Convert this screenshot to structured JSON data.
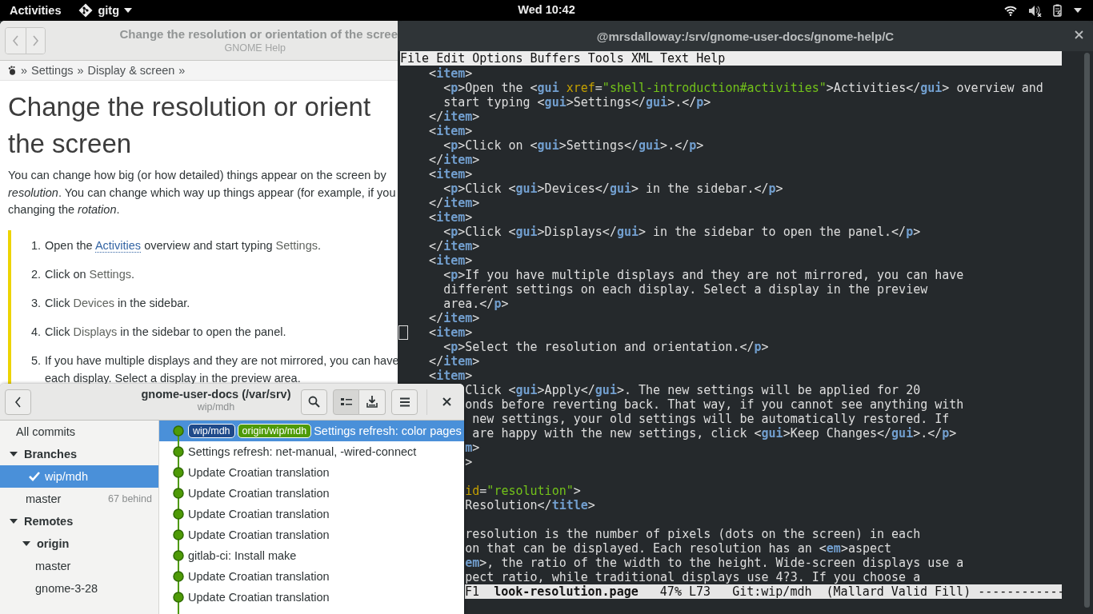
{
  "top_bar": {
    "activities": "Activities",
    "app_menu": "gitg",
    "clock": "Wed 10:42"
  },
  "help_window": {
    "title": "Change the resolution or orientation of the scree",
    "subtitle": "GNOME Help",
    "breadcrumb": [
      "»",
      "Settings",
      "»",
      "Display & screen",
      "»"
    ],
    "heading_lines": [
      "Change the resolution or orient",
      "the screen"
    ],
    "intro_lines": [
      "You can change how big (or how detailed) things appear on the screen by",
      "*resolution*. You can change which way up things appear (for example, if you",
      "changing the *rotation*."
    ],
    "steps": [
      {
        "number": "1.",
        "lines": [
          [
            {
              "kind": "text",
              "text": "Open the "
            },
            {
              "kind": "link",
              "text": "Activities"
            },
            {
              "kind": "text",
              "text": " overview and start typing "
            },
            {
              "kind": "gui",
              "text": "Settings"
            },
            {
              "kind": "text",
              "text": "."
            }
          ]
        ]
      },
      {
        "number": "2.",
        "lines": [
          [
            {
              "kind": "text",
              "text": "Click on "
            },
            {
              "kind": "gui",
              "text": "Settings"
            },
            {
              "kind": "text",
              "text": "."
            }
          ]
        ]
      },
      {
        "number": "3.",
        "lines": [
          [
            {
              "kind": "text",
              "text": "Click "
            },
            {
              "kind": "gui",
              "text": "Devices"
            },
            {
              "kind": "text",
              "text": " in the sidebar."
            }
          ]
        ]
      },
      {
        "number": "4.",
        "lines": [
          [
            {
              "kind": "text",
              "text": "Click "
            },
            {
              "kind": "gui",
              "text": "Displays"
            },
            {
              "kind": "text",
              "text": " in the sidebar to open the panel."
            }
          ]
        ]
      },
      {
        "number": "5.",
        "lines": [
          [
            {
              "kind": "text",
              "text": "If you have multiple displays and they are not mirrored, you can have"
            }
          ],
          [
            {
              "kind": "text",
              "text": "each display. Select a display in the preview area."
            }
          ]
        ]
      }
    ]
  },
  "emacs_window": {
    "title": "@mrsdalloway:/srv/gnome-user-docs/gnome-help/C",
    "menu": [
      "File",
      "Edit",
      "Options",
      "Buffers",
      "Tools",
      "XML",
      "Text",
      "Help"
    ],
    "lines": [
      {
        "kind": "code",
        "text": "    <item>",
        "cut": false,
        "cursor": false
      },
      {
        "kind": "code",
        "text": "      <p>Open the <gui xref=\"shell-introduction#activities\">Activities</gui> overview and",
        "cut": false,
        "cursor": false
      },
      {
        "kind": "code",
        "text": "      start typing <gui>Settings</gui>.</p>",
        "cut": false,
        "cursor": false
      },
      {
        "kind": "code",
        "text": "    </item>",
        "cut": false,
        "cursor": false
      },
      {
        "kind": "code",
        "text": "    <item>",
        "cut": false,
        "cursor": false
      },
      {
        "kind": "code",
        "text": "      <p>Click on <gui>Settings</gui>.</p>",
        "cut": false,
        "cursor": false
      },
      {
        "kind": "code",
        "text": "    </item>",
        "cut": false,
        "cursor": false
      },
      {
        "kind": "code",
        "text": "    <item>",
        "cut": false,
        "cursor": false
      },
      {
        "kind": "code",
        "text": "      <p>Click <gui>Devices</gui> in the sidebar.</p>",
        "cut": false,
        "cursor": false
      },
      {
        "kind": "code",
        "text": "    </item>",
        "cut": false,
        "cursor": false
      },
      {
        "kind": "code",
        "text": "    <item>",
        "cut": false,
        "cursor": false
      },
      {
        "kind": "code",
        "text": "      <p>Click <gui>Displays</gui> in the sidebar to open the panel.</p>",
        "cut": false,
        "cursor": false
      },
      {
        "kind": "code",
        "text": "    </item>",
        "cut": false,
        "cursor": false
      },
      {
        "kind": "code",
        "text": "    <item>",
        "cut": false,
        "cursor": false
      },
      {
        "kind": "code",
        "text": "      <p>If you have multiple displays and they are not mirrored, you can have",
        "cut": false,
        "cursor": false
      },
      {
        "kind": "code",
        "text": "      different settings on each display. Select a display in the preview",
        "cut": false,
        "cursor": false
      },
      {
        "kind": "code",
        "text": "      area.</p>",
        "cut": false,
        "cursor": false
      },
      {
        "kind": "code",
        "text": "    </item>",
        "cut": false,
        "cursor": false
      },
      {
        "kind": "code",
        "text": "    <item>",
        "cut": false,
        "cursor": true
      },
      {
        "kind": "code",
        "text": "      <p>Select the resolution and orientation.</p>",
        "cut": false,
        "cursor": false
      },
      {
        "kind": "code",
        "text": "    </item>",
        "cut": false,
        "cursor": false
      },
      {
        "kind": "code",
        "text": "    <item>",
        "cut": false,
        "cursor": false
      },
      {
        "kind": "code",
        "text": "Click <gui>Apply</gui>. The new settings will be applied for 20",
        "cut": true,
        "cursor": false
      },
      {
        "kind": "code",
        "text": "onds before reverting back. That way, if you cannot see anything with",
        "cut": true,
        "cursor": false
      },
      {
        "kind": "code",
        "text": " new settings, your old settings will be automatically restored. If",
        "cut": true,
        "cursor": false
      },
      {
        "kind": "code",
        "text": " are happy with the new settings, click <gui>Keep Changes</gui>.</p>",
        "cut": true,
        "cursor": false
      },
      {
        "kind": "code",
        "text": "m>",
        "cut": true,
        "cursor": false
      },
      {
        "kind": "code",
        "text": ">",
        "cut": true,
        "cursor": false
      },
      {
        "kind": "blank"
      },
      {
        "kind": "code",
        "text": "id=\"resolution\">",
        "cut": true,
        "cursor": false
      },
      {
        "kind": "code",
        "text": "Resolution</title>",
        "cut": true,
        "cursor": false
      },
      {
        "kind": "blank"
      },
      {
        "kind": "code",
        "text": "resolution is the number of pixels (dots on the screen) in each",
        "cut": true,
        "cursor": false
      },
      {
        "kind": "code",
        "text": "on that can be displayed. Each resolution has an <em>aspect",
        "cut": true,
        "cursor": false
      },
      {
        "kind": "code",
        "text": "em>, the ratio of the width to the height. Wide-screen displays use a",
        "cut": true,
        "cursor": false
      },
      {
        "kind": "code",
        "text": "pect ratio, while traditional displays use 4?3. If you choose a",
        "cut": true,
        "cursor": false
      }
    ],
    "mode_line": "F1  **look-resolution.page**   47% L73   Git:wip/mdh  (Mallard Valid Fill) ------------"
  },
  "gitg_window": {
    "title": "gnome-user-docs (/var/srv)",
    "subtitle": "wip/mdh",
    "view_toggles": [
      {
        "kind": "list",
        "selected": true
      },
      {
        "kind": "download",
        "selected": false
      }
    ],
    "sidebar": [
      {
        "kind": "item",
        "label": "All commits",
        "selected": false
      },
      {
        "kind": "group",
        "label": "Branches",
        "expanded": true,
        "children": [
          {
            "kind": "item",
            "label": "wip/mdh",
            "selected": true,
            "checked": true
          },
          {
            "kind": "item",
            "label": "master",
            "selected": false,
            "checked": false,
            "note": "67 behind"
          }
        ]
      },
      {
        "kind": "group",
        "label": "Remotes",
        "expanded": true,
        "children": [
          {
            "kind": "group",
            "label": "origin",
            "expanded": true,
            "children": [
              {
                "kind": "item",
                "label": "master",
                "selected": false
              },
              {
                "kind": "item",
                "label": "gnome-3-28",
                "selected": false
              }
            ]
          }
        ]
      }
    ],
    "commits": [
      {
        "message": "Settings refresh: color pages",
        "selected": true,
        "refs": [
          {
            "name": "wip/mdh",
            "color": "#1f4a8a"
          },
          {
            "name": "origin/wip/mdh",
            "color": "#4e9a06"
          }
        ]
      },
      {
        "message": "Settings refresh: net-manual, -wired-connect",
        "selected": false
      },
      {
        "message": "Update Croatian translation",
        "selected": false
      },
      {
        "message": "Update Croatian translation",
        "selected": false
      },
      {
        "message": "Update Croatian translation",
        "selected": false
      },
      {
        "message": "Update Croatian translation",
        "selected": false
      },
      {
        "message": "gitlab-ci: Install make",
        "selected": false
      },
      {
        "message": "Update Croatian translation",
        "selected": false
      },
      {
        "message": "Update Croatian translation",
        "selected": false
      }
    ]
  }
}
